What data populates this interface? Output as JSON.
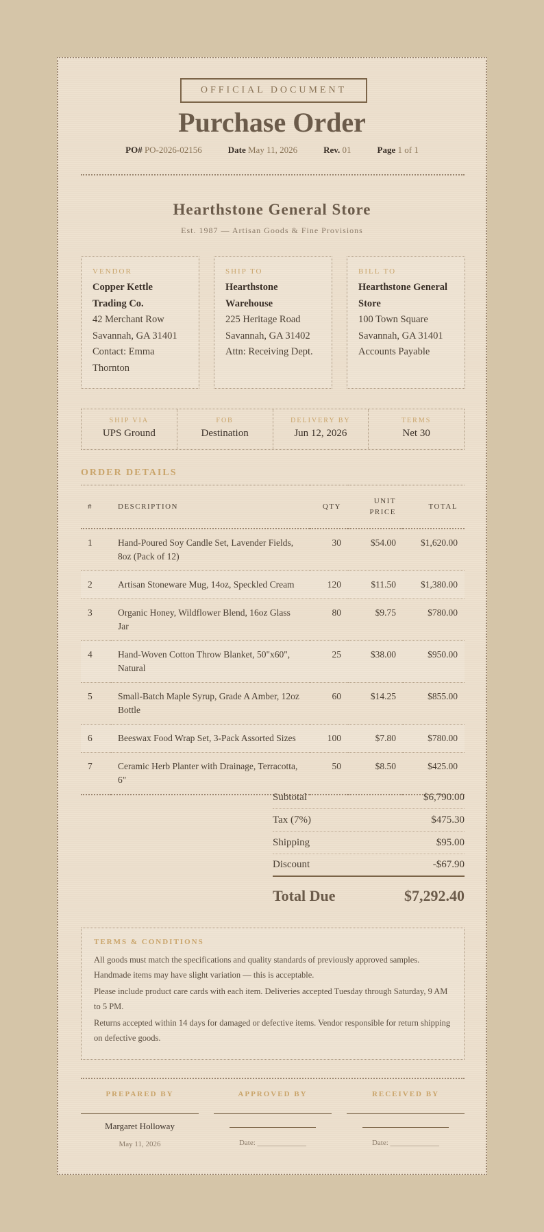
{
  "header": {
    "stamp": "OFFICIAL DOCUMENT",
    "title": "Purchase Order",
    "po_label": "PO#",
    "po_value": "PO-2026-02156",
    "date_label": "Date",
    "date_value": "May 11, 2026",
    "rev_label": "Rev.",
    "rev_value": "01",
    "page_label": "Page",
    "page_value": "1 of 1"
  },
  "store": {
    "name": "Hearthstone General Store",
    "tagline": "Est. 1987 — Artisan Goods & Fine Provisions"
  },
  "parties": {
    "vendor": {
      "label": "VENDOR",
      "name_lines": [
        "Copper Kettle",
        "Trading Co."
      ],
      "lines": [
        "42 Merchant Row",
        "Savannah, GA 31401",
        "Contact: Emma",
        "Thornton"
      ]
    },
    "ship_to": {
      "label": "SHIP TO",
      "name_lines": [
        "Hearthstone",
        "Warehouse"
      ],
      "lines": [
        "225 Heritage Road",
        "Savannah, GA 31402",
        "Attn: Receiving Dept."
      ]
    },
    "bill_to": {
      "label": "BILL TO",
      "name_lines": [
        "Hearthstone General",
        "Store"
      ],
      "lines": [
        "100 Town Square",
        "Savannah, GA 31401",
        "Accounts Payable"
      ]
    }
  },
  "shipping": [
    {
      "label": "SHIP VIA",
      "value": "UPS Ground"
    },
    {
      "label": "FOB",
      "value": "Destination"
    },
    {
      "label": "DELIVERY BY",
      "value": "Jun 12, 2026"
    },
    {
      "label": "TERMS",
      "value": "Net 30"
    }
  ],
  "order": {
    "section_title": "ORDER DETAILS",
    "columns": {
      "num": "#",
      "desc": "DESCRIPTION",
      "qty": "QTY",
      "price_1": "UNIT",
      "price_2": "PRICE",
      "total": "TOTAL"
    },
    "rows": [
      {
        "num": "1",
        "desc": "Hand-Poured Soy Candle Set, Lavender Fields, 8oz (Pack of 12)",
        "qty": "30",
        "price": "$54.00",
        "total": "$1,620.00"
      },
      {
        "num": "2",
        "desc": "Artisan Stoneware Mug, 14oz, Speckled Cream",
        "qty": "120",
        "price": "$11.50",
        "total": "$1,380.00"
      },
      {
        "num": "3",
        "desc": "Organic Honey, Wildflower Blend, 16oz Glass Jar",
        "qty": "80",
        "price": "$9.75",
        "total": "$780.00"
      },
      {
        "num": "4",
        "desc": "Hand-Woven Cotton Throw Blanket, 50\"x60\", Natural",
        "qty": "25",
        "price": "$38.00",
        "total": "$950.00"
      },
      {
        "num": "5",
        "desc": "Small-Batch Maple Syrup, Grade A Amber, 12oz Bottle",
        "qty": "60",
        "price": "$14.25",
        "total": "$855.00"
      },
      {
        "num": "6",
        "desc": "Beeswax Food Wrap Set, 3-Pack Assorted Sizes",
        "qty": "100",
        "price": "$7.80",
        "total": "$780.00"
      },
      {
        "num": "7",
        "desc": "Ceramic Herb Planter with Drainage, Terracotta, 6\"",
        "qty": "50",
        "price": "$8.50",
        "total": "$425.00"
      }
    ]
  },
  "totals": {
    "subtotal_label": "Subtotal",
    "subtotal": "$6,790.00",
    "tax_label": "Tax (7%)",
    "tax": "$475.30",
    "shipping_label": "Shipping",
    "shipping": "$95.00",
    "discount_label": "Discount",
    "discount": "-$67.90",
    "total_label": "Total Due",
    "total": "$7,292.40"
  },
  "terms": {
    "title": "TERMS & CONDITIONS",
    "paragraphs": [
      "All goods must match the specifications and quality standards of previously approved samples. Handmade items may have slight variation — this is acceptable.",
      "Please include product care cards with each item. Deliveries accepted Tuesday through Saturday, 9 AM to 5 PM.",
      "Returns accepted within 14 days for damaged or defective items. Vendor responsible for return shipping on defective goods."
    ]
  },
  "signatures": {
    "prepared": {
      "label": "PREPARED BY",
      "name": "Margaret Holloway",
      "date": "May 11, 2026"
    },
    "approved": {
      "label": "APPROVED BY",
      "date_label": "Date: _____________"
    },
    "received": {
      "label": "RECEIVED BY",
      "date_label": "Date: _____________"
    }
  },
  "colors": {
    "background": "#d5c5a8",
    "paper": "#ede0cd",
    "accent_gold": "#c9a46a",
    "heading_brown": "#6b5b4a"
  }
}
